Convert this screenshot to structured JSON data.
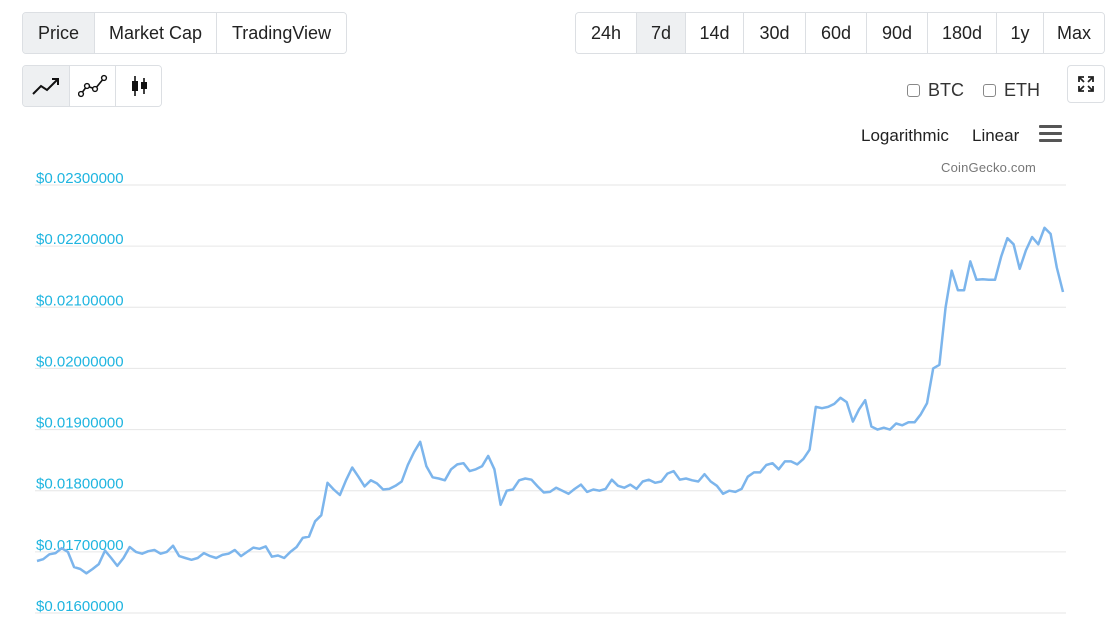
{
  "view_tabs": [
    {
      "label": "Price",
      "active": true
    },
    {
      "label": "Market Cap",
      "active": false
    },
    {
      "label": "TradingView",
      "active": false
    }
  ],
  "range_tabs": [
    {
      "label": "24h",
      "active": false
    },
    {
      "label": "7d",
      "active": true
    },
    {
      "label": "14d",
      "active": false
    },
    {
      "label": "30d",
      "active": false
    },
    {
      "label": "60d",
      "active": false
    },
    {
      "label": "90d",
      "active": false
    },
    {
      "label": "180d",
      "active": false
    },
    {
      "label": "1y",
      "active": false
    },
    {
      "label": "Max",
      "active": false
    }
  ],
  "chart_types": [
    {
      "icon": "line-chart-icon",
      "active": true
    },
    {
      "icon": "point-line-chart-icon",
      "active": false
    },
    {
      "icon": "candlestick-icon",
      "active": false
    }
  ],
  "currencies": [
    {
      "label": "BTC",
      "checked": false
    },
    {
      "label": "ETH",
      "checked": false
    }
  ],
  "scale_options": {
    "log": "Logarithmic",
    "linear": "Linear"
  },
  "credit": "CoinGecko.com",
  "colors": {
    "line": "#7cb5ec",
    "axis_label": "#1fb5e0",
    "grid": "#e6e6e6"
  },
  "chart_data": {
    "type": "line",
    "title": "",
    "xlabel": "",
    "ylabel": "",
    "ylim": [
      0.016,
      0.023
    ],
    "yticks": [
      0.016,
      0.017,
      0.018,
      0.019,
      0.02,
      0.021,
      0.022,
      0.023
    ],
    "ytick_labels": [
      "$0.01600000",
      "$0.01700000",
      "$0.01800000",
      "$0.01900000",
      "$0.02000000",
      "$0.02100000",
      "$0.02200000",
      "$0.02300000"
    ],
    "grid": true,
    "series": [
      {
        "values": [
          0.01685,
          0.01688,
          0.01696,
          0.01698,
          0.01706,
          0.017,
          0.01675,
          0.01672,
          0.01665,
          0.01672,
          0.0168,
          0.01702,
          0.0169,
          0.01677,
          0.0169,
          0.01708,
          0.017,
          0.01697,
          0.01701,
          0.01703,
          0.01697,
          0.017,
          0.0171,
          0.01693,
          0.0169,
          0.01687,
          0.0169,
          0.01698,
          0.01693,
          0.0169,
          0.01695,
          0.01697,
          0.01703,
          0.01693,
          0.017,
          0.01707,
          0.01705,
          0.01709,
          0.01692,
          0.01694,
          0.0169,
          0.017,
          0.01708,
          0.01723,
          0.01725,
          0.0175,
          0.0176,
          0.01813,
          0.01802,
          0.01793,
          0.01817,
          0.01838,
          0.01823,
          0.01807,
          0.01817,
          0.01812,
          0.01802,
          0.01803,
          0.01808,
          0.01815,
          0.01842,
          0.01863,
          0.0188,
          0.0184,
          0.01822,
          0.0182,
          0.01817,
          0.01835,
          0.01843,
          0.01845,
          0.01832,
          0.01835,
          0.0184,
          0.01857,
          0.01835,
          0.01777,
          0.018,
          0.01802,
          0.01817,
          0.0182,
          0.01818,
          0.01807,
          0.01797,
          0.01798,
          0.01805,
          0.018,
          0.01795,
          0.01803,
          0.0181,
          0.01798,
          0.01802,
          0.018,
          0.01803,
          0.01818,
          0.01808,
          0.01805,
          0.0181,
          0.01803,
          0.01815,
          0.01818,
          0.01813,
          0.01815,
          0.01828,
          0.01832,
          0.01818,
          0.0182,
          0.01817,
          0.01815,
          0.01827,
          0.01815,
          0.01808,
          0.01795,
          0.018,
          0.01798,
          0.01803,
          0.01823,
          0.0183,
          0.0183,
          0.01842,
          0.01845,
          0.01835,
          0.01848,
          0.01848,
          0.01843,
          0.01852,
          0.01867,
          0.01937,
          0.01935,
          0.01937,
          0.01942,
          0.01952,
          0.01945,
          0.01913,
          0.01933,
          0.01948,
          0.01905,
          0.019,
          0.01903,
          0.019,
          0.0191,
          0.01907,
          0.01912,
          0.01912,
          0.01925,
          0.01943,
          0.02,
          0.02006,
          0.021,
          0.0216,
          0.02128,
          0.02128,
          0.02175,
          0.02145,
          0.02146,
          0.02145,
          0.02145,
          0.02183,
          0.02213,
          0.02203,
          0.02163,
          0.02193,
          0.02215,
          0.02203,
          0.0223,
          0.0222,
          0.02165,
          0.02125
        ]
      }
    ]
  }
}
